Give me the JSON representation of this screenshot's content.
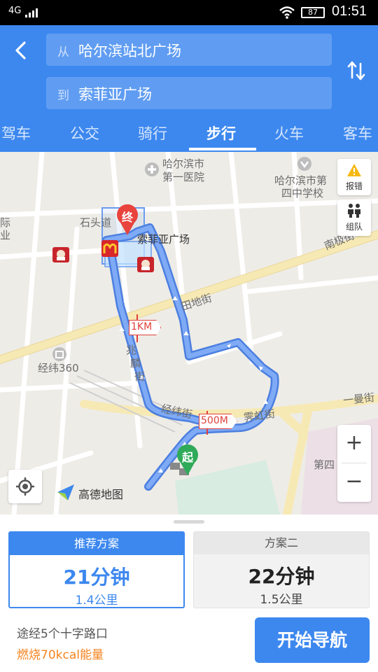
{
  "status_bar": {
    "network": "4G",
    "battery": "87",
    "time": "01:51"
  },
  "header": {
    "from_tag": "从",
    "from_value": "哈尔滨站北广场",
    "to_tag": "到",
    "to_value": "索菲亚广场",
    "tabs": [
      {
        "label": "驾车",
        "active": false
      },
      {
        "label": "公交",
        "active": false
      },
      {
        "label": "骑行",
        "active": false
      },
      {
        "label": "步行",
        "active": true
      },
      {
        "label": "火车",
        "active": false
      },
      {
        "label": "客车",
        "active": false
      }
    ]
  },
  "map": {
    "labels": {
      "hospital": [
        "哈尔滨市",
        "第一医院"
      ],
      "school": [
        "哈尔滨市第",
        "四中学校"
      ],
      "shitou": "石头道",
      "sophia": "索菲亚广场",
      "nanji": "南极街",
      "tiandi": "田地街",
      "zhaolin": [
        "兆",
        "麟",
        "街"
      ],
      "jingwei360": "经纬360",
      "jingwei_street": "经纬街",
      "xiahong": "霁虹街",
      "yiman": "一曼街",
      "disi": "第四",
      "left_edge": "际",
      "left_edge2": "业"
    },
    "markers": {
      "end": "终",
      "start": "起",
      "km1": "1KM",
      "m500": "500M"
    },
    "report_error": "报错",
    "group": "组队",
    "zoom_in": "+",
    "zoom_out": "−",
    "brand": "高德地图",
    "route_color": "#6a9bf0"
  },
  "plans": [
    {
      "title": "推荐方案",
      "time": "21分钟",
      "distance": "1.4公里"
    },
    {
      "title": "方案二",
      "time": "22分钟",
      "distance": "1.5公里"
    }
  ],
  "summary": {
    "crossings": "途经5个十字路口",
    "calories": "燃烧70kcal能量"
  },
  "start_nav": "开始导航"
}
